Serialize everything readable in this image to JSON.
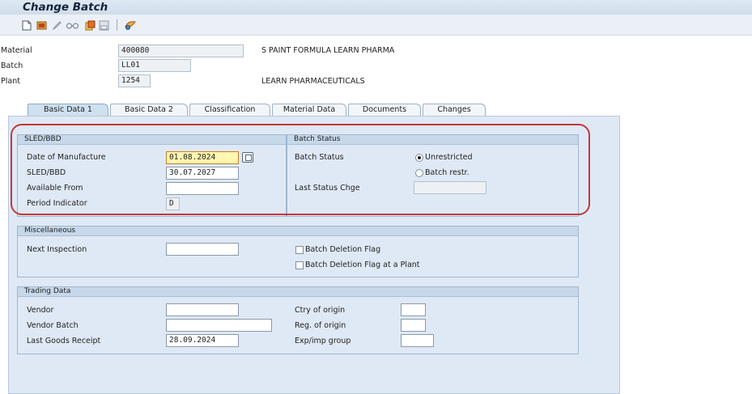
{
  "window": {
    "title": "Change Batch"
  },
  "toolbar": {
    "icons": [
      "new-document-icon",
      "display-change-icon",
      "pencil-icon",
      "glasses-icon",
      "copy-icon",
      "save-variant-icon",
      "settings-icon"
    ]
  },
  "header": {
    "material_label": "Material",
    "material_value": "400080",
    "material_desc": "S PAINT FORMULA LEARN PHARMA",
    "batch_label": "Batch",
    "batch_value": "LL01",
    "plant_label": "Plant",
    "plant_value": "1254",
    "plant_desc": "LEARN PHARMACEUTICALS"
  },
  "tabs": [
    {
      "label": "Basic Data 1",
      "active": true
    },
    {
      "label": "Basic Data 2",
      "active": false
    },
    {
      "label": "Classification",
      "active": false
    },
    {
      "label": "Material Data",
      "active": false
    },
    {
      "label": "Documents",
      "active": false
    },
    {
      "label": "Changes",
      "active": false
    }
  ],
  "sled": {
    "title": "SLED/BBD",
    "mfg_label": "Date of Manufacture",
    "mfg_value": "01.08.2024",
    "sled_label": "SLED/BBD",
    "sled_value": "30.07.2027",
    "avail_label": "Available From",
    "avail_value": "",
    "period_label": "Period Indicator",
    "period_value": "D"
  },
  "batch_status": {
    "title": "Batch Status",
    "status_label": "Batch Status",
    "opt_unrestricted": "Unrestricted",
    "opt_restricted": "Batch restr.",
    "selected": "Unrestricted",
    "last_change_label": "Last Status Chge",
    "last_change_value": ""
  },
  "misc": {
    "title": "Miscellaneous",
    "next_insp_label": "Next Inspection",
    "next_insp_value": "",
    "del_flag_label": "Batch Deletion Flag",
    "del_flag_plant_label": "Batch Deletion Flag at a Plant"
  },
  "trading": {
    "title": "Trading Data",
    "vendor_label": "Vendor",
    "vendor_value": "",
    "vendor_batch_label": "Vendor Batch",
    "vendor_batch_value": "",
    "lgr_label": "Last Goods Receipt",
    "lgr_value": "28.09.2024",
    "ctry_label": "Ctry of origin",
    "ctry_value": "",
    "reg_label": "Reg. of origin",
    "reg_value": "",
    "exp_label": "Exp/imp group",
    "exp_value": ""
  },
  "colors": {
    "panel_bg": "#dfe9f5",
    "group_head": "#c6d8ea",
    "highlight": "#c0393b",
    "active_field": "#fff7b0"
  }
}
